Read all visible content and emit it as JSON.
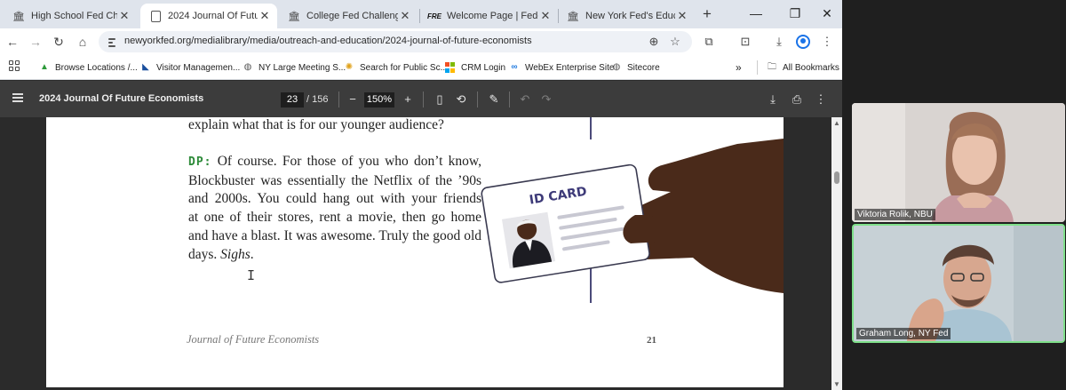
{
  "tabs": [
    {
      "title": "High School Fed Challenge",
      "favicon": "building-icon"
    },
    {
      "title": "2024 Journal Of Future Economists",
      "favicon": "document-icon"
    },
    {
      "title": "College Fed Challenge - Fe",
      "favicon": "building-icon"
    },
    {
      "title": "Welcome Page | Federal Re",
      "favicon": "fre-icon"
    },
    {
      "title": "New York Fed's Education",
      "favicon": "building-icon"
    }
  ],
  "address_bar": {
    "url": "newyorkfed.org/medialibrary/media/outreach-and-education/2024-journal-of-future-economists"
  },
  "bookmarks": [
    {
      "label": "Browse Locations /..."
    },
    {
      "label": "Visitor Managemen..."
    },
    {
      "label": "NY Large Meeting S..."
    },
    {
      "label": "Search for Public Sc..."
    },
    {
      "label": "CRM Login"
    },
    {
      "label": "WebEx Enterprise Site"
    },
    {
      "label": "Sitecore"
    }
  ],
  "bookmarks_more": "»",
  "all_bookmarks": "All Bookmarks",
  "pdf": {
    "title": "2024 Journal Of Future Economists",
    "current_page": "23",
    "total_pages": "/ 156",
    "zoom": "150%"
  },
  "document": {
    "question_tail": "explain what that is for our younger audience?",
    "speaker": "DP:",
    "answer_lines": [
      "Of course. For those of you who don’t know,",
      "Blockbuster was essentially the Netflix of the ’90s",
      "and 2000s. You could hang out with your friends",
      "at one of their stores, rent a movie, then go home",
      "and have a blast. It was awesome. Truly the good old",
      "days."
    ],
    "answer_end_italic": "Sighs",
    "answer_end_period": ".",
    "card_label": "ID CARD",
    "footer_journal": "Journal of Future Economists",
    "footer_page": "21"
  },
  "participants": [
    {
      "name": "Viktoria Rolik, NBU"
    },
    {
      "name": "Graham Long, NY Fed"
    }
  ],
  "colors": {
    "speaker": "#2e8b3a",
    "card_title": "#3d3a78",
    "hand": "#4a2a1a",
    "active_speaker_border": "#7fe08a"
  }
}
